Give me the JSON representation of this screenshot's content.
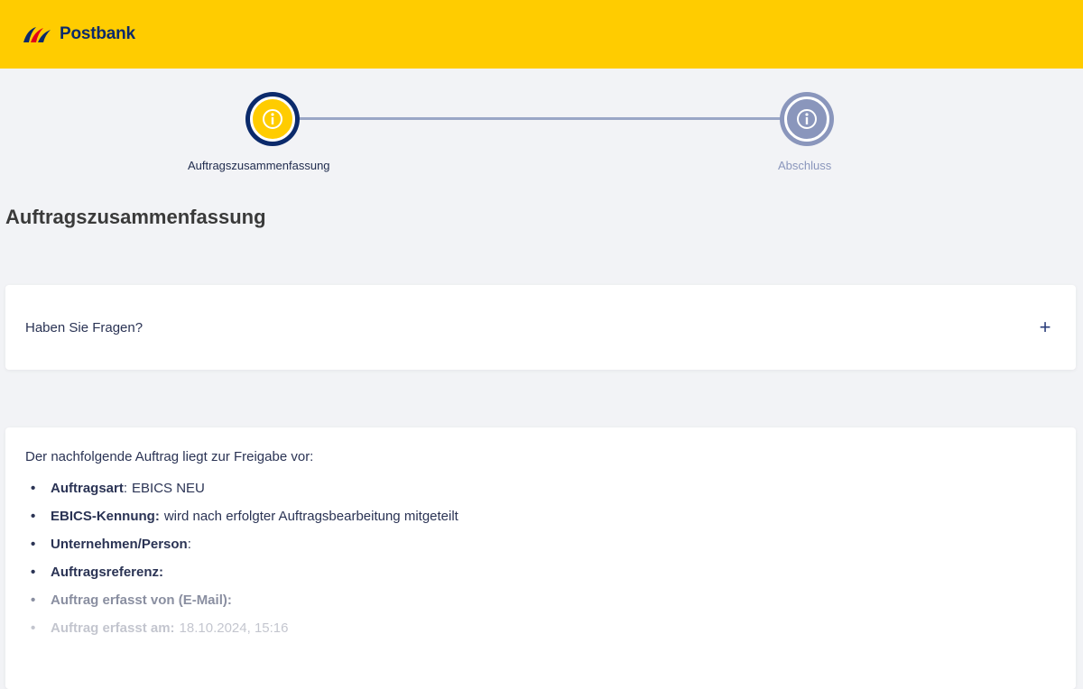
{
  "header": {
    "brand": "Postbank",
    "brand_color": "#ffcc00"
  },
  "stepper": {
    "steps": [
      {
        "label": "Auftragszusammenfassung",
        "state": "active",
        "icon": "info-icon"
      },
      {
        "label": "Abschluss",
        "state": "inactive",
        "icon": "info-icon"
      }
    ]
  },
  "page": {
    "title": "Auftragszusammenfassung"
  },
  "faq": {
    "question": "Haben Sie Fragen?",
    "expand_icon": "plus-icon",
    "expand_symbol": "+"
  },
  "summary": {
    "intro": "Der nachfolgende Auftrag liegt zur Freigabe vor:",
    "items": [
      {
        "key": "Auftragsart",
        "sep": ":",
        "value": "EBICS NEU"
      },
      {
        "key": "EBICS-Kennung:",
        "sep": "",
        "value": "wird nach erfolgter Auftragsbearbeitung mitgeteilt"
      },
      {
        "key": "Unternehmen/Person",
        "sep": ":",
        "value": ""
      },
      {
        "key": "Auftragsreferenz:",
        "sep": "",
        "value": ""
      },
      {
        "key": "Auftrag erfasst von (E-Mail):",
        "sep": "",
        "value": ""
      },
      {
        "key": "Auftrag erfasst am:",
        "sep": "",
        "value": "18.10.2024, 15:16"
      }
    ]
  }
}
